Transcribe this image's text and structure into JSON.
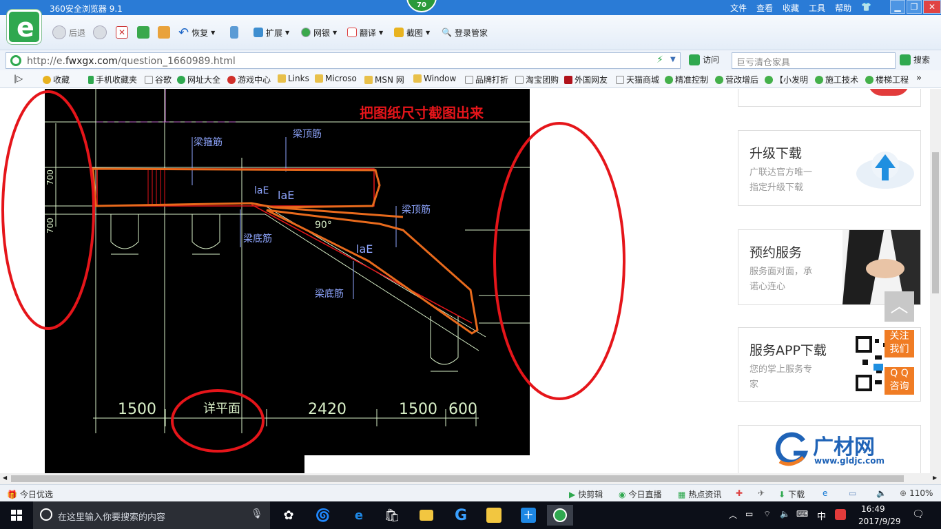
{
  "titlebar": {
    "title": "360安全浏览器 9.1",
    "badge": "70",
    "menus": [
      "文件",
      "查看",
      "收藏",
      "工具",
      "帮助"
    ]
  },
  "toolbar": {
    "back": "后退",
    "restore": "恢复",
    "extend": "扩展",
    "bank": "网银",
    "translate": "翻译",
    "screenshot": "截图",
    "login": "登录管家"
  },
  "address": {
    "url_prefix": "http://e.",
    "url_domain": "fwxgx.com",
    "url_path": "/question_1660989.html",
    "visit": "访问",
    "search_placeholder": "巨亏清仓家具",
    "search_button": "搜索"
  },
  "bookmarks": [
    {
      "label": "收藏",
      "color": "#e8b320"
    },
    {
      "label": "手机收藏夹",
      "color": "#2fa84f"
    },
    {
      "label": "谷歌",
      "color": "#ffffff"
    },
    {
      "label": "网址大全",
      "color": "#2fa84f"
    },
    {
      "label": "游戏中心",
      "color": "#d0302b"
    },
    {
      "label": "Links",
      "color": "#e8c04a"
    },
    {
      "label": "Microso",
      "color": "#e8c04a"
    },
    {
      "label": "MSN 网",
      "color": "#e8c04a"
    },
    {
      "label": "Window",
      "color": "#e8c04a"
    },
    {
      "label": "品牌打折",
      "color": "#ffffff"
    },
    {
      "label": "淘宝团购",
      "color": "#ffffff"
    },
    {
      "label": "外国网友",
      "color": "#b0121b"
    },
    {
      "label": "天猫商城",
      "color": "#ffffff"
    },
    {
      "label": "精准控制",
      "color": "#44b04a"
    },
    {
      "label": "营改增后",
      "color": "#44b04a"
    },
    {
      "label": "【小发明",
      "color": "#44b04a"
    },
    {
      "label": "施工技术",
      "color": "#44b04a"
    },
    {
      "label": "楼梯工程",
      "color": "#44b04a"
    }
  ],
  "drawing": {
    "caption": "把图纸尺寸截图出来",
    "labels": {
      "stirrup": "梁箍筋",
      "top_bar_1": "梁顶筋",
      "top_bar_2": "梁顶筋",
      "bottom_bar_1": "梁底筋",
      "bottom_bar_2": "梁底筋",
      "lae_1": "laE",
      "lae_2": "laE",
      "lae_3": "laE",
      "angle": "90°",
      "detail": "详平面"
    },
    "dimensions": [
      "1500",
      "2420",
      "1500",
      "600"
    ],
    "left_dims": [
      "700",
      "700"
    ]
  },
  "sidebar": {
    "upgrade": {
      "title": "升级下载",
      "desc_1": "广联达官方唯一",
      "desc_2": "指定升级下载"
    },
    "booking": {
      "title": "预约服务",
      "desc_1": "服务面对面，承",
      "desc_2": "诺心连心"
    },
    "app": {
      "title": "服务APP下载",
      "desc_1": "您的掌上服务专",
      "desc_2": "家"
    },
    "brand": {
      "name": "广材网",
      "url": "www.gldjc.com"
    },
    "follow_1": "关注",
    "follow_2": "我们",
    "qq_1": "Q Q",
    "qq_2": "咨询"
  },
  "statusbar": {
    "left": "今日优选",
    "clip": "快剪辑",
    "live": "今日直播",
    "news": "热点资讯",
    "download": "下载",
    "zoom": "110%"
  },
  "taskbar": {
    "search_placeholder": "在这里输入你要搜索的内容",
    "ime": "中",
    "time": "16:49",
    "date": "2017/9/29"
  },
  "colors": {
    "cad_bg": "#000000",
    "cad_line": "#d9f0c8",
    "cad_label": "#8fa6ff",
    "cad_orange": "#e86a1c",
    "annotation_red": "#e5151a",
    "brand_blue": "#1f63b7",
    "side_orange": "#f07c24"
  }
}
